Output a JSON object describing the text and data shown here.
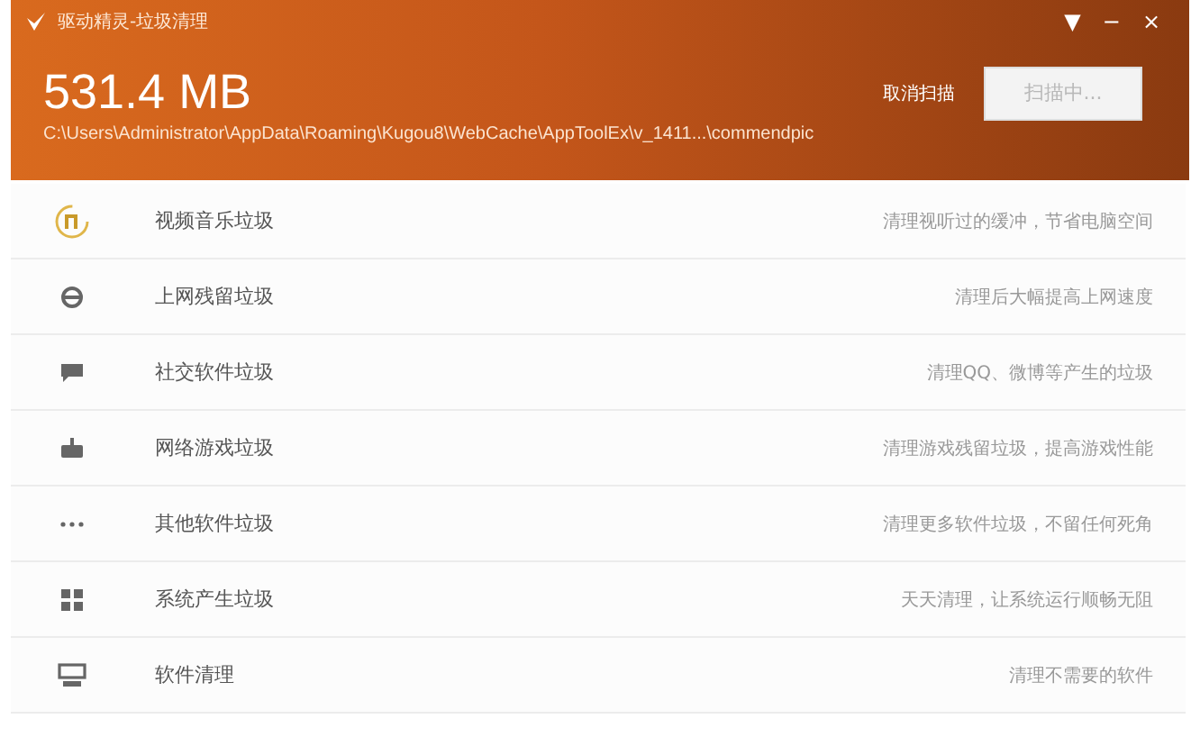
{
  "window": {
    "title": "驱动精灵-垃圾清理",
    "controls": [
      "▼",
      "−",
      "×"
    ]
  },
  "scan": {
    "size": "531.4 MB",
    "path": "C:\\Users\\Administrator\\AppData\\Roaming\\Kugou8\\WebCache\\AppToolEx\\v_1411...\\commendpic",
    "cancel": "取消扫描",
    "button": "扫描中...",
    "button_disabled": true
  },
  "items": [
    {
      "kind": "music",
      "name": "视频音乐垃圾",
      "description": "清理视听过的缓冲，节省电脑空间"
    },
    {
      "kind": "browser",
      "name": "上网残留垃圾",
      "description": "清理后大幅提高上网速度"
    },
    {
      "kind": "chat",
      "name": "社交软件垃圾",
      "description": "清理QQ、微博等产生的垃圾"
    },
    {
      "kind": "game",
      "name": "网络游戏垃圾",
      "description": "清理游戏残留垃圾，提高游戏性能"
    },
    {
      "kind": "more",
      "name": "其他软件垃圾",
      "description": "清理更多软件垃圾，不留任何死角"
    },
    {
      "kind": "windows",
      "name": "系统产生垃圾",
      "description": "天天清理，让系统运行顺畅无阻"
    },
    {
      "kind": "software",
      "name": "软件清理",
      "description": "清理不需要的软件"
    }
  ]
}
